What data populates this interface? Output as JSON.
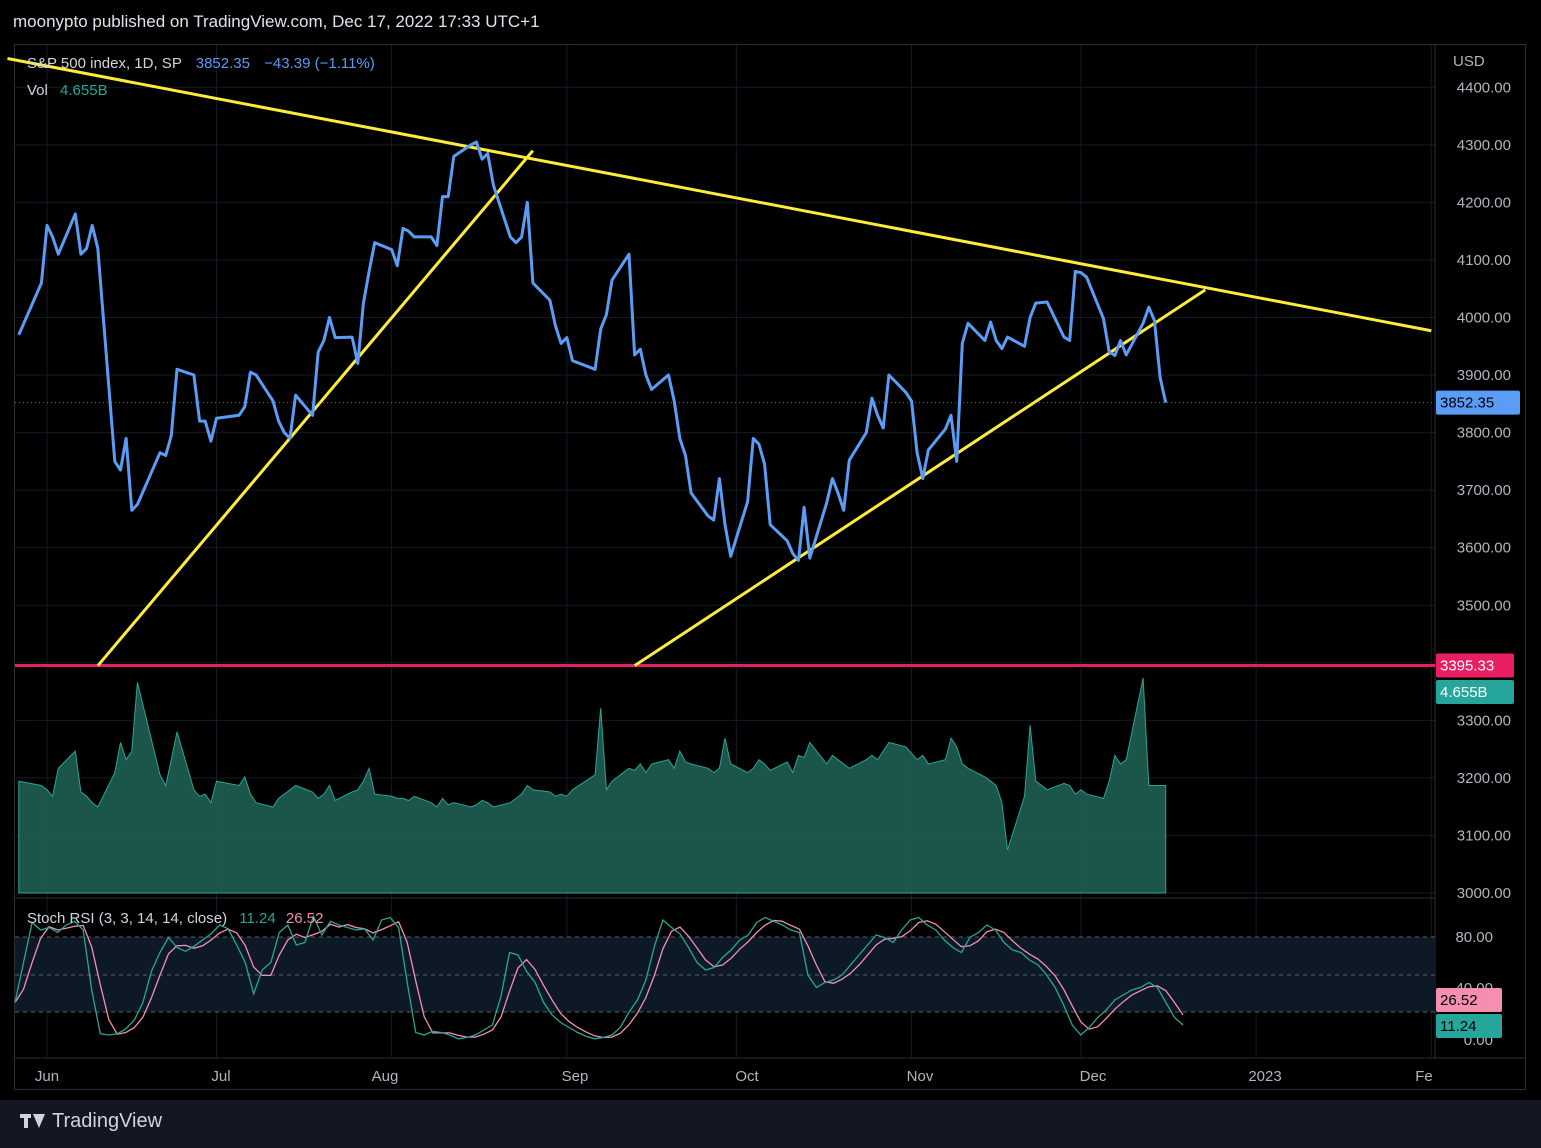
{
  "header": {
    "publisher_line": "moonypto published on TradingView.com, Dec 17, 2022 17:33 UTC+1"
  },
  "legend": {
    "symbol": "S&P 500 index, 1D, SP",
    "price": "3852.35",
    "change": "−43.39 (−1.11%)",
    "vol_label": "Vol",
    "vol_value": "4.655B",
    "stoch_label": "Stoch RSI (3, 3, 14, 14, close)",
    "stoch_k": "11.24",
    "stoch_d": "26.52"
  },
  "footer": {
    "brand": "TradingView"
  },
  "colors": {
    "price_line": "#5b9cf6",
    "trendline": "#ffeb3b",
    "support": "#e91e63",
    "volume": "#26a69a",
    "stoch_k": "#26a69a",
    "stoch_d": "#f48fb1"
  },
  "chart_data": {
    "type": "line",
    "currency": "USD",
    "x_ticks": [
      "Jun",
      "Jul",
      "Aug",
      "Sep",
      "Oct",
      "Nov",
      "Dec",
      "2023",
      "Fe"
    ],
    "y_ticks": [
      "4400.00",
      "4300.00",
      "4200.00",
      "4100.00",
      "4000.00",
      "3900.00",
      "3800.00",
      "3700.00",
      "3600.00",
      "3500.00",
      "3400.00",
      "3300.00",
      "3200.00",
      "3100.00",
      "3000.00"
    ],
    "ylim": [
      3000,
      4450
    ],
    "price_series": {
      "name": "S&P 500 index",
      "x": [
        "2022-05-27",
        "2022-05-31",
        "2022-06-01",
        "2022-06-02",
        "2022-06-03",
        "2022-06-06",
        "2022-06-07",
        "2022-06-08",
        "2022-06-09",
        "2022-06-10",
        "2022-06-13",
        "2022-06-14",
        "2022-06-15",
        "2022-06-16",
        "2022-06-17",
        "2022-06-21",
        "2022-06-22",
        "2022-06-23",
        "2022-06-24",
        "2022-06-27",
        "2022-06-28",
        "2022-06-29",
        "2022-06-30",
        "2022-07-01",
        "2022-07-05",
        "2022-07-06",
        "2022-07-07",
        "2022-07-08",
        "2022-07-11",
        "2022-07-12",
        "2022-07-13",
        "2022-07-14",
        "2022-07-15",
        "2022-07-18",
        "2022-07-19",
        "2022-07-20",
        "2022-07-21",
        "2022-07-22",
        "2022-07-25",
        "2022-07-26",
        "2022-07-27",
        "2022-07-28",
        "2022-07-29",
        "2022-08-01",
        "2022-08-02",
        "2022-08-03",
        "2022-08-04",
        "2022-08-05",
        "2022-08-08",
        "2022-08-09",
        "2022-08-10",
        "2022-08-11",
        "2022-08-12",
        "2022-08-15",
        "2022-08-16",
        "2022-08-17",
        "2022-08-18",
        "2022-08-19",
        "2022-08-22",
        "2022-08-23",
        "2022-08-24",
        "2022-08-25",
        "2022-08-26",
        "2022-08-29",
        "2022-08-30",
        "2022-08-31",
        "2022-09-01",
        "2022-09-02",
        "2022-09-06",
        "2022-09-07",
        "2022-09-08",
        "2022-09-09",
        "2022-09-12",
        "2022-09-13",
        "2022-09-14",
        "2022-09-15",
        "2022-09-16",
        "2022-09-19",
        "2022-09-20",
        "2022-09-21",
        "2022-09-22",
        "2022-09-23",
        "2022-09-26",
        "2022-09-27",
        "2022-09-28",
        "2022-09-29",
        "2022-09-30",
        "2022-10-03",
        "2022-10-04",
        "2022-10-05",
        "2022-10-06",
        "2022-10-07",
        "2022-10-10",
        "2022-10-11",
        "2022-10-12",
        "2022-10-13",
        "2022-10-14",
        "2022-10-17",
        "2022-10-18",
        "2022-10-19",
        "2022-10-20",
        "2022-10-21",
        "2022-10-24",
        "2022-10-25",
        "2022-10-26",
        "2022-10-27",
        "2022-10-28",
        "2022-10-31",
        "2022-11-01",
        "2022-11-02",
        "2022-11-03",
        "2022-11-04",
        "2022-11-07",
        "2022-11-08",
        "2022-11-09",
        "2022-11-10",
        "2022-11-11",
        "2022-11-14",
        "2022-11-15",
        "2022-11-16",
        "2022-11-17",
        "2022-11-18",
        "2022-11-21",
        "2022-11-22",
        "2022-11-23",
        "2022-11-25",
        "2022-11-28",
        "2022-11-29",
        "2022-11-30",
        "2022-12-01",
        "2022-12-02",
        "2022-12-05",
        "2022-12-06",
        "2022-12-07",
        "2022-12-08",
        "2022-12-09",
        "2022-12-12",
        "2022-12-13",
        "2022-12-14",
        "2022-12-15",
        "2022-12-16"
      ],
      "values": [
        3970,
        4060,
        4160,
        4140,
        4110,
        4180,
        4110,
        4120,
        4160,
        4120,
        3750,
        3735,
        3790,
        3665,
        3675,
        3765,
        3760,
        3795,
        3910,
        3900,
        3820,
        3820,
        3785,
        3825,
        3830,
        3845,
        3905,
        3900,
        3855,
        3820,
        3800,
        3790,
        3865,
        3830,
        3940,
        3960,
        4000,
        3965,
        3966,
        3920,
        4025,
        4080,
        4130,
        4118,
        4090,
        4155,
        4150,
        4140,
        4140,
        4125,
        4210,
        4210,
        4280,
        4300,
        4305,
        4275,
        4285,
        4230,
        4140,
        4130,
        4140,
        4200,
        4060,
        4030,
        3985,
        3955,
        3965,
        3925,
        3910,
        3980,
        4005,
        4065,
        4110,
        3935,
        3945,
        3900,
        3875,
        3900,
        3855,
        3790,
        3760,
        3695,
        3655,
        3648,
        3720,
        3640,
        3585,
        3680,
        3790,
        3780,
        3745,
        3640,
        3612,
        3590,
        3578,
        3670,
        3582,
        3678,
        3720,
        3695,
        3665,
        3752,
        3800,
        3860,
        3830,
        3808,
        3900,
        3870,
        3855,
        3765,
        3720,
        3770,
        3806,
        3830,
        3750,
        3955,
        3990,
        3960,
        3992,
        3960,
        3946,
        3966,
        3950,
        4000,
        4025,
        4027,
        3966,
        3960,
        4080,
        4078,
        4070,
        3998,
        3940,
        3934,
        3960,
        3935,
        3990,
        4018,
        3995,
        3896,
        3852
      ]
    },
    "volume_series": {
      "name": "Vol",
      "last_value": "4.655B"
    },
    "stoch_rsi": {
      "name": "Stoch RSI (3, 3, 14, 14, close)",
      "k": 11.24,
      "d": 26.52,
      "levels": [
        "80.00",
        "40.00",
        "0.00"
      ]
    },
    "annotations": [
      {
        "type": "horizontal_line",
        "value": 3395.33,
        "label": "3395.33"
      },
      {
        "type": "trendline",
        "from": [
          "2022-05-25",
          4450
        ],
        "to": [
          "2023-02-01",
          3977
        ]
      },
      {
        "type": "trendline",
        "from": [
          "2022-06-10",
          3395
        ],
        "to": [
          "2022-08-26",
          4290
        ]
      },
      {
        "type": "trendline",
        "from": [
          "2022-09-13",
          3395
        ],
        "to": [
          "2022-12-23",
          4048
        ]
      }
    ],
    "last_price_label": "3852.35"
  }
}
